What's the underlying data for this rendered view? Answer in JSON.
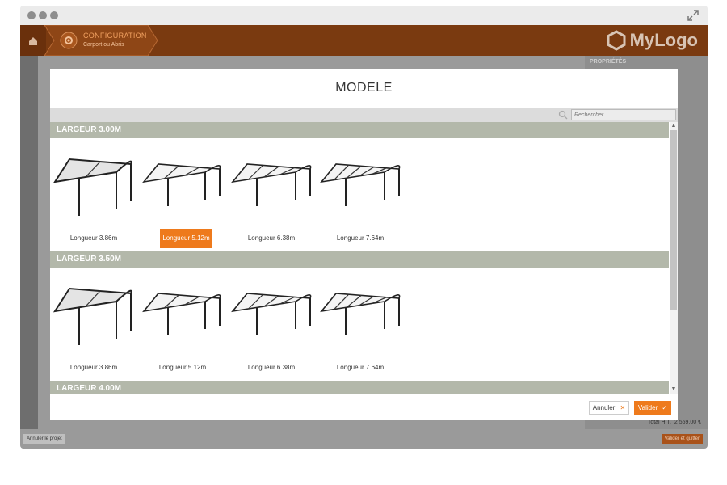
{
  "header": {
    "title": "CONFIGURATION",
    "subtitle": "Carport ou Abris",
    "logo_text": "MyLogo"
  },
  "right_panel": {
    "title": "PROPRIÉTÉS"
  },
  "footer": {
    "cancel_project": "Annuler le projet",
    "validate_quit": "Valider et quitter",
    "total_label": "Total H.T.",
    "total_value": "2 559,00 €"
  },
  "modal": {
    "title": "MODELE",
    "search_placeholder": "Rechercher...",
    "sections": [
      {
        "label": "LARGEUR 3.00M",
        "items": [
          {
            "label": "Longueur 3.86m",
            "selected": false
          },
          {
            "label": "Longueur 5.12m",
            "selected": true
          },
          {
            "label": "Longueur 6.38m",
            "selected": false
          },
          {
            "label": "Longueur 7.64m",
            "selected": false
          }
        ]
      },
      {
        "label": "LARGEUR 3.50M",
        "items": [
          {
            "label": "Longueur 3.86m",
            "selected": false
          },
          {
            "label": "Longueur 5.12m",
            "selected": false
          },
          {
            "label": "Longueur 6.38m",
            "selected": false
          },
          {
            "label": "Longueur 7.64m",
            "selected": false
          }
        ]
      },
      {
        "label": "LARGEUR 4.00M",
        "items": []
      }
    ],
    "buttons": {
      "cancel": "Annuler",
      "validate": "Valider"
    }
  },
  "icons": {
    "home": "home-icon",
    "settings": "gear-icon",
    "expand": "expand-icon",
    "search": "search-icon",
    "close": "close-icon",
    "check": "check-icon"
  },
  "colors": {
    "header_bg": "#7a3a10",
    "accent": "#ee7a1c",
    "section_bg": "#b3b8aa"
  }
}
